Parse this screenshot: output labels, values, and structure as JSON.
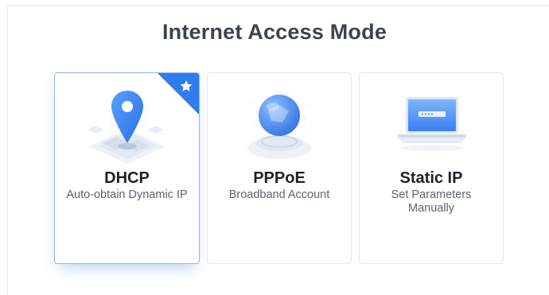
{
  "page": {
    "title": "Internet Access Mode"
  },
  "modes": [
    {
      "name": "DHCP",
      "desc": "Auto-obtain Dynamic IP",
      "icon": "location-pin-icon",
      "selected": true
    },
    {
      "name": "PPPoE",
      "desc": "Broadband Account",
      "icon": "globe-icon",
      "selected": false
    },
    {
      "name": "Static IP",
      "desc": "Set Parameters Manually",
      "icon": "laptop-icon",
      "selected": false
    }
  ],
  "colors": {
    "accent": "#2f7bf0",
    "selected_border": "#8fb6ef",
    "title": "#3d4350"
  }
}
